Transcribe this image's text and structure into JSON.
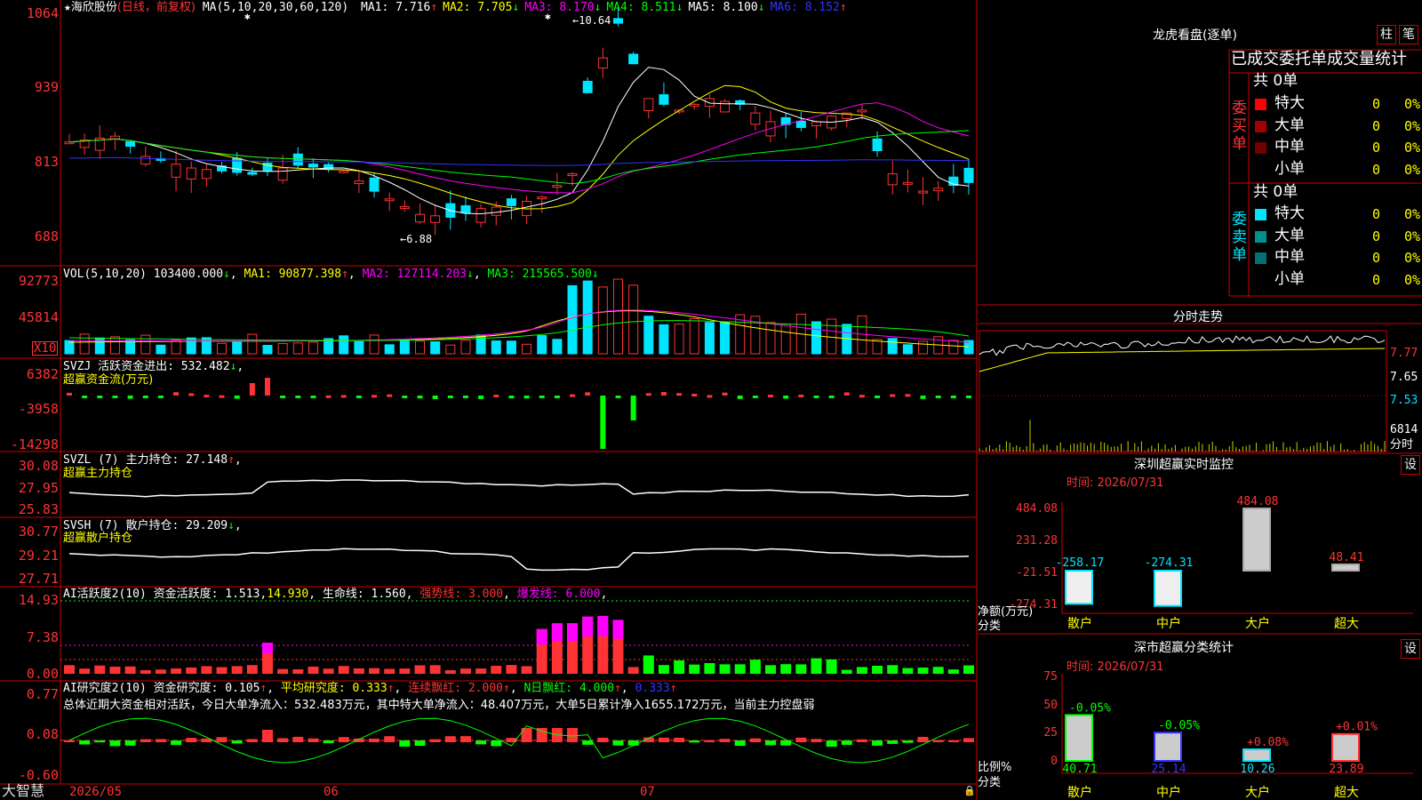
{
  "app": {
    "brand": "大智慧"
  },
  "main_chart": {
    "star": "★",
    "stock_name": "海欣股份",
    "period": "(日线，前复权)",
    "ma_header": "MA(5,10,20,30,60,120)",
    "ma_items": [
      {
        "label": "MA1: 7.716",
        "arrow": "↑",
        "color": "#ffffff"
      },
      {
        "label": "MA2: 7.705",
        "arrow": "↓",
        "color": "#ffff00"
      },
      {
        "label": "MA3: 8.170",
        "arrow": "↓",
        "color": "#ff00ff"
      },
      {
        "label": "MA4: 8.511",
        "arrow": "↓",
        "color": "#00ff00"
      },
      {
        "label": "MA5: 8.100",
        "arrow": "↓",
        "color": "#ffffff"
      },
      {
        "label": "MA6: 8.152",
        "arrow": "↑",
        "color": "#3333ff"
      }
    ],
    "y_ticks": [
      "1064",
      "939",
      "813",
      "688"
    ],
    "high_label": "10.64",
    "low_label": "6.88"
  },
  "vol_panel": {
    "title": "VOL(5,10,20)",
    "value": "103400.000",
    "value_arrow": "↓",
    "ma1": "MA1: 90877.398",
    "ma1_arrow": "↑",
    "ma2": "MA2: 127114.203",
    "ma2_arrow": "↓",
    "ma3": "MA3: 215565.500",
    "ma3_arrow": "↓",
    "y_ticks": [
      "92773",
      "45814"
    ],
    "unit": "X10"
  },
  "svzj_panel": {
    "title": "SVZJ",
    "label": "活跃资金进出: 532.482",
    "arrow": "↓",
    "subtitle": "超赢资金流(万元)",
    "y_ticks": [
      "6382",
      "-3958",
      "-14298"
    ]
  },
  "svzl_panel": {
    "title": "SVZL (7)",
    "label": "主力持仓: 27.148",
    "arrow": "↑",
    "subtitle": "超赢主力持仓",
    "y_ticks": [
      "30.08",
      "27.95",
      "25.83"
    ]
  },
  "svsh_panel": {
    "title": "SVSH (7)",
    "label": "散户持仓: 29.209",
    "arrow": "↓",
    "subtitle": "超赢散户持仓",
    "y_ticks": [
      "30.77",
      "29.21",
      "27.71"
    ]
  },
  "ai_active_panel": {
    "title": "AI活跃度2(10)",
    "label": "资金活跃度: 1.513",
    "value2": "14.930",
    "life": "生命线: 1.560",
    "strong": "强势线: 3.000",
    "burst": "爆发线: 6.000",
    "y_ticks": [
      "14.93",
      "7.38",
      "0.00"
    ]
  },
  "ai_research_panel": {
    "title": "AI研究度2(10)",
    "label": "资金研究度: 0.105",
    "avg": "平均研究度: 0.333",
    "red": "连续飘红: 2.000",
    "nred": "N日飘红: 4.000",
    "last": "0.333",
    "summary": "总体近期大资金相对活跃，今日大单净流入：532.483万元，其中特大单净流入：48.407万元，大单5日累计净入1655.172万元，当前主力控盘弱",
    "y_ticks": [
      "0.77",
      "0.08",
      "-0.60"
    ]
  },
  "x_axis": {
    "labels": [
      "2026/05",
      "06",
      "07"
    ]
  },
  "dragon_tiger": {
    "title": "龙虎看盘(逐单)",
    "btn_bar": "柱",
    "btn_pen": "笔",
    "subtitle": "已成交委托单成交量统计",
    "buy_label": "委买单",
    "sell_label": "委卖单",
    "buy_total": "共 0单",
    "sell_total": "共 0单",
    "buy_rows": [
      {
        "name": "特大",
        "count": "0",
        "pct": "0%",
        "color": "#ff0000"
      },
      {
        "name": "大单",
        "count": "0",
        "pct": "0%",
        "color": "#a00000"
      },
      {
        "name": "中单",
        "count": "0",
        "pct": "0%",
        "color": "#700000"
      },
      {
        "name": "小单",
        "count": "0",
        "pct": "0%",
        "color": "#000000"
      }
    ],
    "sell_rows": [
      {
        "name": "特大",
        "count": "0",
        "pct": "0%",
        "color": "#00e5ff"
      },
      {
        "name": "大单",
        "count": "0",
        "pct": "0%",
        "color": "#009090"
      },
      {
        "name": "中单",
        "count": "0",
        "pct": "0%",
        "color": "#007070"
      },
      {
        "name": "小单",
        "count": "0",
        "pct": "0%",
        "color": "#000000"
      }
    ]
  },
  "intraday": {
    "title": "分时走势",
    "ticks": [
      "7.77",
      "7.65",
      "7.53"
    ],
    "vol_label": "6814",
    "unit": "分时"
  },
  "monitor": {
    "title": "深圳超赢实时监控",
    "btn": "设",
    "time": "时间: 2026/07/31",
    "y_ticks": [
      "484.08",
      "231.28",
      "-21.51",
      "-274.31"
    ],
    "y_label": "净额(万元)",
    "x_label": "分类",
    "categories": [
      "散户",
      "中户",
      "大户",
      "超大"
    ],
    "values": [
      -258.17,
      -274.31,
      484.08,
      48.41
    ],
    "value_labels": [
      "-258.17",
      "-274.31",
      "484.08",
      "48.41"
    ]
  },
  "stats": {
    "title": "深市超赢分类统计",
    "btn": "设",
    "time": "时间: 2026/07/31",
    "y_ticks": [
      "75",
      "50",
      "25",
      "0"
    ],
    "y_label": "比例%",
    "x_label": "分类",
    "categories": [
      "散户",
      "中户",
      "大户",
      "超大"
    ],
    "values": [
      40.71,
      25.14,
      10.26,
      23.89
    ],
    "changes": [
      "-0.05%",
      "-0.05%",
      "+0.08%",
      "+0.01%"
    ],
    "value_labels": [
      "40.71",
      "25.14",
      "10.26",
      "23.89"
    ],
    "colors": [
      "#00ff00",
      "#3333ff",
      "#00e5ff",
      "#ff3333"
    ]
  }
}
